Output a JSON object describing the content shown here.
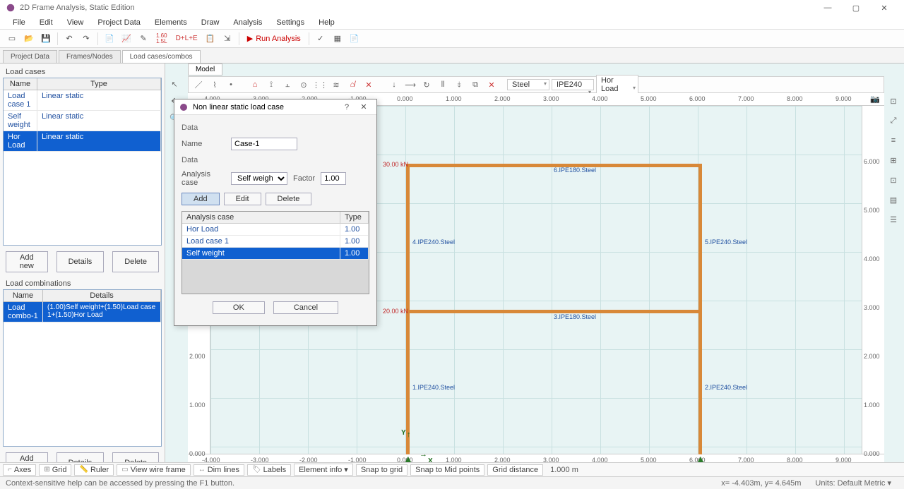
{
  "app": {
    "title": "2D Frame Analysis, Static Edition"
  },
  "menu": [
    "File",
    "Edit",
    "View",
    "Project Data",
    "Elements",
    "Draw",
    "Analysis",
    "Settings",
    "Help"
  ],
  "toolbar": {
    "run": "Run Analysis",
    "ratio": "1.60\n1.5L",
    "dll": "D+L+E"
  },
  "tabs": [
    "Project Data",
    "Frames/Nodes",
    "Load cases/combos"
  ],
  "sidebar": {
    "loadcases_title": "Load cases",
    "lc_head": {
      "name": "Name",
      "type": "Type"
    },
    "lc_rows": [
      {
        "name": "Load case 1",
        "type": "Linear static"
      },
      {
        "name": "Self weight",
        "type": "Linear static"
      },
      {
        "name": "Hor Load",
        "type": "Linear static"
      }
    ],
    "btns": {
      "add": "Add new",
      "details": "Details",
      "delete": "Delete"
    },
    "combos_title": "Load combinations",
    "co_head": {
      "name": "Name",
      "details": "Details"
    },
    "co_rows": [
      {
        "name": "Load combo-1",
        "details": "(1.00)Self weight+(1.50)Load case 1+(1.50)Hor Load"
      }
    ]
  },
  "canvas": {
    "model_tab": "Model",
    "material": "Steel",
    "section": "IPE240",
    "loadcase": "Hor Load",
    "ruler_x": [
      "-4.000",
      "-3.000",
      "-2.000",
      "-1.000",
      "0.000",
      "1.000",
      "2.000",
      "3.000",
      "4.000",
      "5.000",
      "6.000",
      "7.000",
      "8.000",
      "9.000"
    ],
    "ruler_y": [
      "6.000",
      "5.000",
      "4.000",
      "3.000",
      "2.000",
      "1.000",
      "0.000"
    ],
    "elements": {
      "e1": "1.IPE240.Steel",
      "e2": "2.IPE240.Steel",
      "e3": "3.IPE180.Steel",
      "e5": "5.IPE240.Steel",
      "e6": "6.IPE180.Steel"
    },
    "loads": {
      "top": "30.00 kN",
      "mid": "20.00 kN"
    },
    "axis": {
      "x": "X",
      "y": "Y"
    },
    "scale": {
      "val": "1.000",
      "unit": "m"
    }
  },
  "dialog": {
    "title": "Non linear static load case",
    "sec1": "Data",
    "name_lbl": "Name",
    "name_val": "Case-1",
    "sec2": "Data",
    "ac_lbl": "Analysis case",
    "ac_val": "Self weight",
    "factor_lbl": "Factor",
    "factor_val": "1.00",
    "btns": {
      "add": "Add",
      "edit": "Edit",
      "delete": "Delete"
    },
    "thead": {
      "ac": "Analysis case",
      "type": "Type"
    },
    "rows": [
      {
        "ac": "Hor Load",
        "type": "1.00"
      },
      {
        "ac": "Load case 1",
        "type": "1.00"
      },
      {
        "ac": "Self weight",
        "type": "1.00"
      }
    ],
    "ok": "OK",
    "cancel": "Cancel"
  },
  "bottombar": {
    "axes": "Axes",
    "grid": "Grid",
    "ruler": "Ruler",
    "wire": "View wire frame",
    "dim": "Dim lines",
    "labels": "Labels",
    "elinfo": "Element info ▾",
    "snapg": "Snap to grid",
    "snapm": "Snap to Mid points",
    "gdist": "Grid distance"
  },
  "status": {
    "help": "Context-sensitive help can be accessed by pressing the F1 button.",
    "coords": "x= -4.403m, y= 4.645m",
    "units": "Units: Default Metric ▾"
  }
}
